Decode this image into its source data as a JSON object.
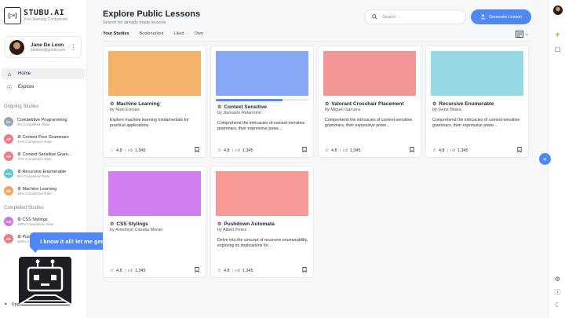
{
  "app": {
    "logo_mark": "[:≡]",
    "name": "STUBU.AI",
    "tagline": "Your learning Companion"
  },
  "user": {
    "name": "Jane De Leon",
    "email": "jdeleon@gmail.com"
  },
  "nav": [
    {
      "label": "Home",
      "icon": "home-icon"
    },
    {
      "label": "Explore",
      "icon": "compass-icon"
    }
  ],
  "ongoing_title": "Ongoing Studies",
  "ongoing": [
    {
      "initials": "CL",
      "color": "#9aa6b2",
      "title": "Competitive Programming",
      "rate": "3% Completion Rate"
    },
    {
      "initials": "AP",
      "color": "#f07a86",
      "title": "⚙ Context Free Grammars",
      "rate": "40% Completion Rate"
    },
    {
      "initials": "AP",
      "color": "#f07a86",
      "title": "⚙ Context Sensitive Gram...",
      "rate": "70% Completion Rate"
    },
    {
      "initials": "OG",
      "color": "#5fc7d3",
      "title": "⚙ Recursive Enumerable",
      "rate": "9% Completion Rate"
    },
    {
      "initials": "NE",
      "color": "#f5a85d",
      "title": "⚙ Machine Learning",
      "rate": "35% Completion Rate"
    }
  ],
  "completed_title": "Completed Studies",
  "completed": [
    {
      "initials": "AM",
      "color": "#d174e0",
      "title": "⚙ CSS Stylings",
      "rate": "100% Completion Rate"
    },
    {
      "initials": "AP",
      "color": "#f07a86",
      "title": "⚙ Pushdown Automata",
      "rate": "100% Completion Rate"
    }
  ],
  "upgrade_label": "Upgrade to PRO Version",
  "assistant_message": "I know it all! let me generate any lessons you need!",
  "header": {
    "title": "Explore Public Lessons",
    "subtitle": "Search for already made lessons",
    "search_placeholder": "Search ...",
    "generate_label": "Generate Lesson"
  },
  "tabs": [
    "Your Studies",
    "Bookmarked",
    "Liked",
    "Own"
  ],
  "active_tab": 0,
  "lessons": [
    {
      "color": "#f5b26b",
      "title": "Machine Learning",
      "author": "by Noel Ernoas",
      "description": "Explore machine learning fundamentals for practical applications.",
      "rating": "4.8",
      "likes": "1,345",
      "progress": null,
      "star_color": "#4f87f3"
    },
    {
      "color": "#86a8f7",
      "title": "Context Sensitive",
      "author": "by Jianxario Relarmino",
      "description": "Comprehend the intricacies of context-sensitive grammars, their expressive powe...",
      "rating": "4.8",
      "likes": "1,345",
      "progress": 0.72,
      "star_color": "#333"
    },
    {
      "color": "#f39696",
      "title": "Valorant Crosshair Placement",
      "author": "by Miguel Garcera",
      "description": "Comprehend the intricacies of context-sensitive grammars, their expressive powe...",
      "rating": "4.8",
      "likes": "1,345",
      "progress": null,
      "star_color": "#333"
    },
    {
      "color": "#96d8e4",
      "title": "Recursive Enumerable",
      "author": "by Gene Bitara",
      "description": "Comprehend the intricacies of context-sensitive grammars, their expressive powe...",
      "rating": "4.8",
      "likes": "1,345",
      "progress": null,
      "star_color": "#333"
    },
    {
      "color": "#d07ef0",
      "title": "CSS Stylings",
      "author": "by Amethyst Claudia Moran",
      "description": "",
      "rating": "4.8",
      "likes": "1,345",
      "progress": null,
      "star_color": "#333"
    },
    {
      "color": "#f79a96",
      "title": "Pushdown Automata",
      "author": "by Albert Perez",
      "description": "Delve into the concept of recursive enumerability, exploring its implications for...",
      "rating": "4.8",
      "likes": "1,345",
      "progress": null,
      "star_color": "#333"
    }
  ]
}
